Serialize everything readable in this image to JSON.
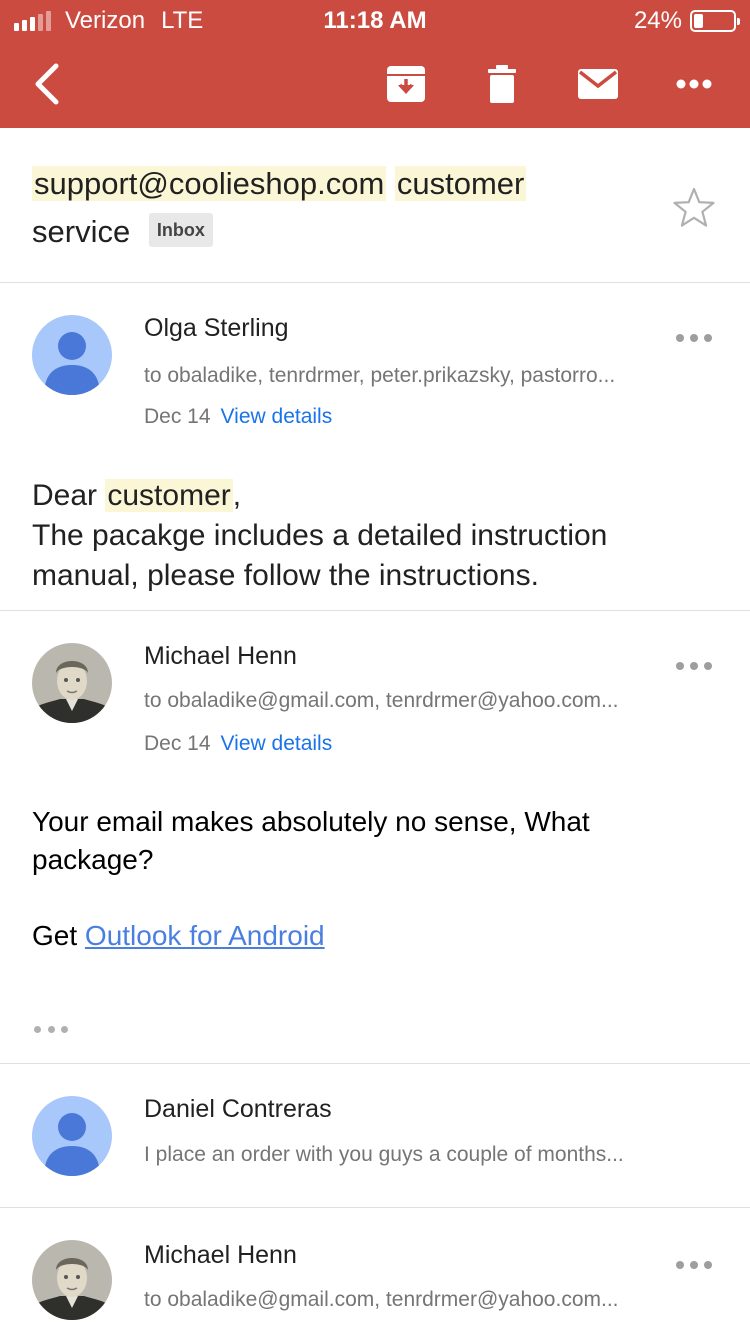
{
  "status_bar": {
    "carrier": "Verizon",
    "network": "LTE",
    "time": "11:18 AM",
    "battery": "24%",
    "battery_level": 0.24
  },
  "toolbar": {
    "back_icon": "chevron-left-icon",
    "archive_icon": "archive-icon",
    "delete_icon": "trash-icon",
    "mark_unread_icon": "mail-icon",
    "more_icon": "more-horizontal-icon"
  },
  "subject": {
    "part1": "support@coolieshop.com",
    "part2": "customer",
    "part3": "service",
    "label": "Inbox",
    "star_icon": "star-outline-icon"
  },
  "messages": [
    {
      "sender": "Olga Sterling",
      "recipients": "to obaladike, tenrdrmer, peter.prikazsky, pastorro...",
      "date": "Dec 14",
      "details_link": "View details",
      "body": {
        "greeting": "Dear",
        "highlight": "customer",
        "greeting_end": ",",
        "line2": "The pacakge includes a detailed instruction manual, please follow the instructions."
      }
    },
    {
      "sender": "Michael Henn",
      "recipients": "to obaladike@gmail.com, tenrdrmer@yahoo.com...",
      "date": "Dec 14",
      "details_link": "View details",
      "body": {
        "line1": "Your email makes absolutely no sense, What package?",
        "get": "Get",
        "link": "Outlook for Android"
      }
    },
    {
      "sender": "Daniel Contreras",
      "snippet": "I place an order with you guys a couple of months..."
    },
    {
      "sender": "Michael Henn",
      "recipients": "to obaladike@gmail.com, tenrdrmer@yahoo.com..."
    }
  ],
  "colors": {
    "toolbar": "#cc4b40",
    "highlight": "#fbf7d6",
    "link": "#1a73e8",
    "avatar_bg": "#a8c7fa",
    "avatar_fg": "#4a78d8"
  }
}
